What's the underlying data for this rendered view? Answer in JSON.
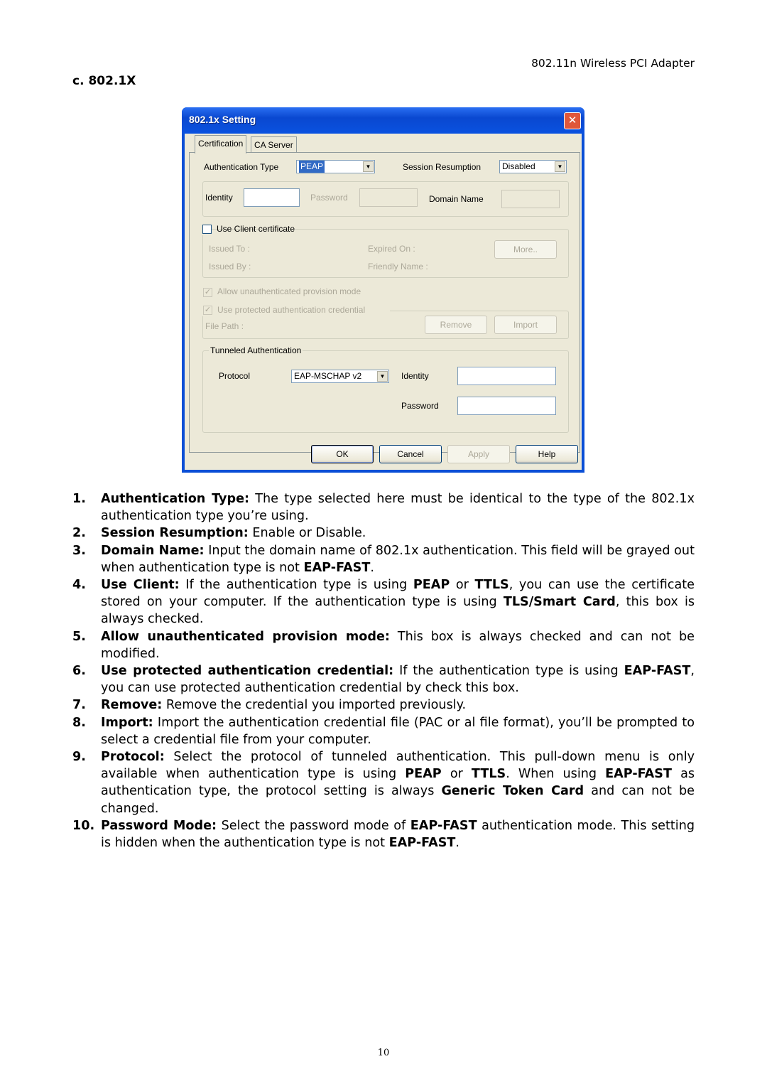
{
  "page": {
    "running_header": "802.11n Wireless PCI Adapter",
    "section_title": "c. 802.1X",
    "page_number": "10"
  },
  "dialog": {
    "title": "802.1x Setting",
    "close_icon": "close-icon",
    "tabs": [
      {
        "label": "Certification",
        "active": true
      },
      {
        "label": "CA Server",
        "active": false
      }
    ],
    "auth_type": {
      "label": "Authentication Type",
      "value": "PEAP"
    },
    "session_resumption": {
      "label": "Session Resumption",
      "value": "Disabled"
    },
    "identity": {
      "label": "Identity",
      "value": ""
    },
    "password": {
      "label": "Password",
      "value": ""
    },
    "domain_name": {
      "label": "Domain Name",
      "value": ""
    },
    "client_cert": {
      "label": "Use Client certificate",
      "checked": false,
      "issued_to": "Issued To :",
      "issued_by": "Issued By :",
      "expired_on": "Expired On :",
      "friendly_name": "Friendly Name :",
      "more_button": "More.."
    },
    "allow_unauth": {
      "label": "Allow unauthenticated provision mode",
      "checked": true
    },
    "use_protected": {
      "label": "Use protected authentication credential",
      "checked": true
    },
    "file_path": "File Path :",
    "remove_button": "Remove",
    "import_button": "Import",
    "tunneled": {
      "group_label": "Tunneled Authentication",
      "protocol_label": "Protocol",
      "protocol_value": "EAP-MSCHAP v2",
      "identity_label": "Identity",
      "identity_value": "",
      "password_label": "Password",
      "password_value": ""
    },
    "buttons": {
      "ok": "OK",
      "cancel": "Cancel",
      "apply": "Apply",
      "help": "Help"
    }
  },
  "instructions": [
    {
      "num": "1.",
      "term": "Authentication Type:",
      "text": " The type selected here must be identical to the type of the 802.1x authentication type you’re using."
    },
    {
      "num": "2.",
      "term": "Session Resumption:",
      "text": "  Enable or Disable."
    },
    {
      "num": "3.",
      "term": "Domain Name:",
      "text": " Input the domain name of 802.1x authentication. This field will be grayed out when authentication type is not ",
      "b1": "EAP-FAST",
      "t2": "."
    },
    {
      "num": "4.",
      "term": "Use Client:",
      "text": " If the authentication type is using ",
      "b1": "PEAP",
      "t2": " or ",
      "b2": "TTLS",
      "t3": ", you can use the certificate stored on your computer. If the authentication type is using ",
      "b3": "TLS/Smart Card",
      "t4": ", this box is always checked."
    },
    {
      "num": "5.",
      "term": "Allow unauthenticated provision mode:",
      "text": " This box is always checked and can not be modified."
    },
    {
      "num": "6.",
      "term": "Use protected authentication credential:",
      "text": " If the authentication type is using ",
      "b1": "EAP-FAST",
      "t2": ", you can use protected authentication credential by check this box."
    },
    {
      "num": "7.",
      "term": "Remove:",
      "text": " Remove the credential you imported previously."
    },
    {
      "num": "8.",
      "term": "Import:",
      "text": " Import the authentication credential file (PAC or al file format), you’ll be prompted to select a credential file from your computer."
    },
    {
      "num": "9.",
      "term": "Protocol:",
      "text": " Select the protocol of tunneled authentication. This pull-down menu is only available when authentication type is using ",
      "b1": "PEAP",
      "t2": " or ",
      "b2": "TTLS",
      "t3": ". When using ",
      "b3": "EAP-FAST",
      "t4": " as authentication type, the protocol setting is always ",
      "b4": "Generic Token Card",
      "t5": " and can not be changed."
    },
    {
      "num": "10.",
      "term": "Password Mode:",
      "text": "  Select the password mode of ",
      "b1": "EAP-FAST",
      "t2": " authentication mode. This setting is hidden when the authentication type is not ",
      "b2": "EAP-FAST",
      "t3": "."
    }
  ]
}
